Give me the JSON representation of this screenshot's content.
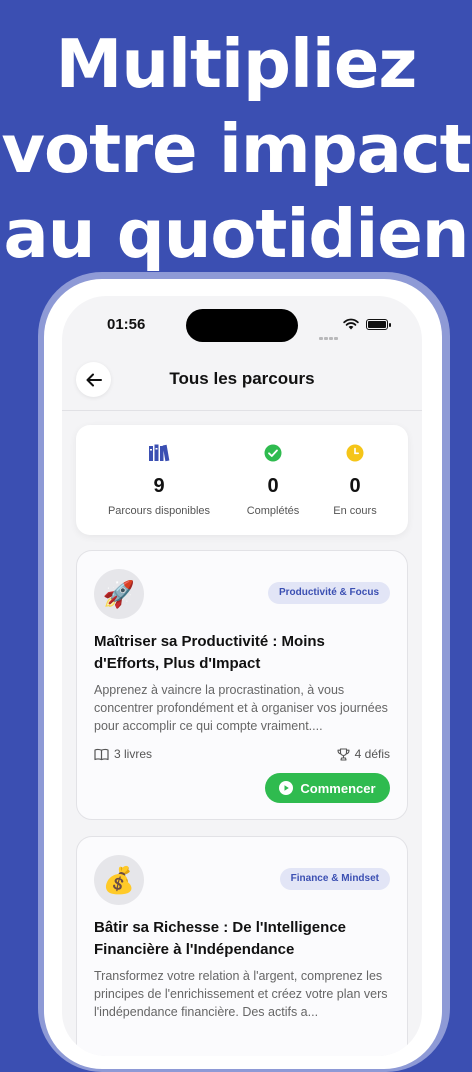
{
  "headline": {
    "line1": "Multipliez",
    "line2": "votre impact",
    "line3": "au quotidien"
  },
  "status_bar": {
    "time": "01:56"
  },
  "header": {
    "title": "Tous les parcours",
    "back_icon": "arrow-left-icon"
  },
  "stats": [
    {
      "icon": "books-icon",
      "value": "9",
      "label": "Parcours disponibles",
      "color": "#3b4fb2"
    },
    {
      "icon": "check-circle-icon",
      "value": "0",
      "label": "Complétés",
      "color": "#2fbb4f"
    },
    {
      "icon": "clock-icon",
      "value": "0",
      "label": "En cours",
      "color": "#f5c518"
    }
  ],
  "cards": [
    {
      "emoji": "🚀",
      "tag": "Productivité & Focus",
      "title": "Maîtriser sa Productivité : Moins d'Efforts, Plus d'Impact",
      "description": "Apprenez à vaincre la procrastination, à vous concentrer profondément et à organiser vos journées pour accomplir ce qui compte vraiment....",
      "books": "3 livres",
      "challenges": "4 défis",
      "button": "Commencer"
    },
    {
      "emoji": "💰",
      "tag": "Finance & Mindset",
      "title": "Bâtir sa Richesse : De l'Intelligence Financière à l'Indépendance",
      "description": "Transformez votre relation à l'argent, comprenez les principes de l'enrichissement et créez votre plan vers l'indépendance financière. Des actifs a..."
    }
  ],
  "colors": {
    "background": "#3b4fb2",
    "accent_green": "#2fbb4f",
    "tag_bg": "#e2e5f6"
  }
}
